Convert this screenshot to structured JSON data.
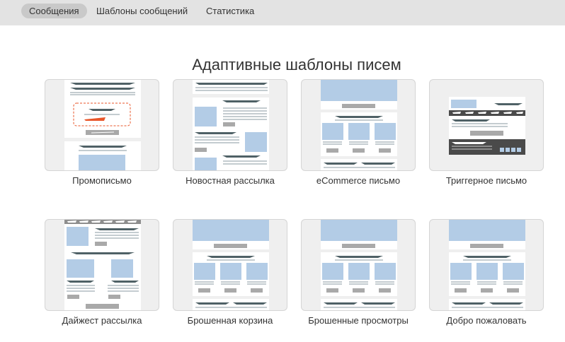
{
  "tabs": [
    {
      "label": "Сообщения",
      "active": true
    },
    {
      "label": "Шаблоны сообщений",
      "active": false
    },
    {
      "label": "Статистика",
      "active": false
    }
  ],
  "page_title": "Адаптивные шаблоны писем",
  "templates": [
    {
      "label": "Промописьмо"
    },
    {
      "label": "Новостная рассылка"
    },
    {
      "label": "eCommerce письмо"
    },
    {
      "label": "Триггерное письмо"
    },
    {
      "label": "Дайжест рассылка"
    },
    {
      "label": "Брошенная корзина"
    },
    {
      "label": "Брошенные просмотры"
    },
    {
      "label": "Добро пожаловать"
    }
  ],
  "colors": {
    "topbar": "#e3e3e3",
    "tab_active": "#c9c9c9",
    "thumb_bg": "#efefef",
    "placeholder_blue": "#b3cce6",
    "stroke_dark": "#4f6166",
    "button_gray": "#a9a9a9",
    "promo_accent": "#e8562a",
    "trigger_dark": "#4a4a4a"
  }
}
